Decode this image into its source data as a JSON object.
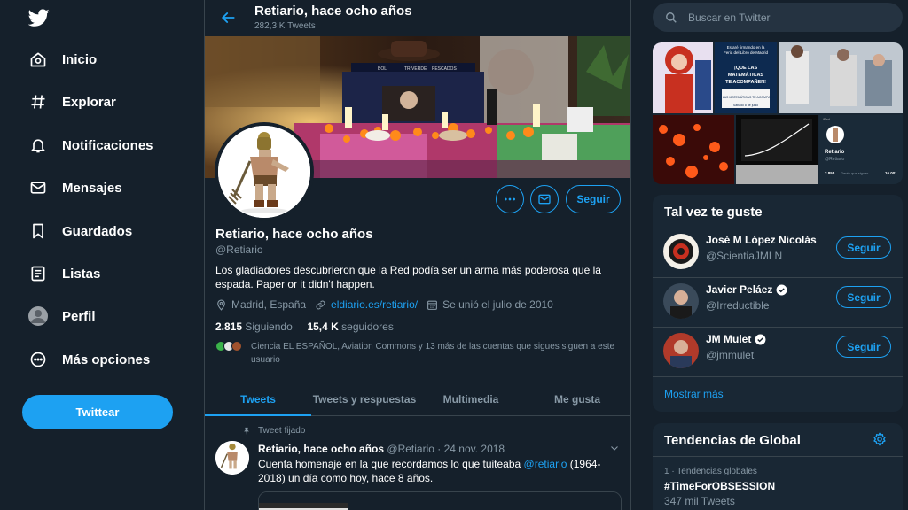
{
  "nav": {
    "items": [
      {
        "label": "Inicio",
        "icon": "home-icon"
      },
      {
        "label": "Explorar",
        "icon": "hashtag-icon"
      },
      {
        "label": "Notificaciones",
        "icon": "bell-icon"
      },
      {
        "label": "Mensajes",
        "icon": "envelope-icon"
      },
      {
        "label": "Guardados",
        "icon": "bookmark-icon"
      },
      {
        "label": "Listas",
        "icon": "list-icon"
      },
      {
        "label": "Perfil",
        "icon": "profile-avatar"
      },
      {
        "label": "Más opciones",
        "icon": "more-circle-icon"
      }
    ],
    "tweet_button": "Twittear"
  },
  "header": {
    "title": "Retiario, hace ocho años",
    "tweet_count": "282,3 K Tweets"
  },
  "banner": {
    "sign_words": [
      "BOLI",
      "TRIVERDE",
      "PESCADOS"
    ]
  },
  "profile": {
    "name": "Retiario, hace ocho años",
    "handle": "@Retiario",
    "bio": "Los gladiadores descubrieron que la Red podía ser un arma más poderosa que la espada. Paper or it didn't happen.",
    "location": "Madrid, España",
    "website": "eldiario.es/retiario/",
    "joined": "Se unió el julio de 2010",
    "following_count": "2.815",
    "following_label": "Siguiendo",
    "followers_count": "15,4 K",
    "followers_label": "seguidores",
    "known_followers": "Ciencia EL ESPAÑOL, Aviation Commons y 13 más de las cuentas que sigues siguen a este usuario",
    "follow_button": "Seguir"
  },
  "tabs": [
    "Tweets",
    "Tweets y respuestas",
    "Multimedia",
    "Me gusta"
  ],
  "pinned_tweet": {
    "pinned_label": "Tweet fijado",
    "author": "Retiario, hace ocho años",
    "handle": "@Retiario",
    "date": "· 24 nov. 2018",
    "text_before": "Cuenta homenaje en la que recordamos lo que tuiteaba ",
    "mention": "@retiario",
    "text_after": " (1964-2018) un día como hoy, hace 8 años."
  },
  "sidebar": {
    "search_placeholder": "Buscar en Twitter",
    "media_preview": {
      "poster_line1": "Estaré firmando en la",
      "poster_line2": "Feria del Libro de Madrid",
      "poster_title1": "¡QUE LAS",
      "poster_title2": "MATEMÁTICAS",
      "poster_title3": "TE ACOMPAÑEN!",
      "book_title": "QUE LAS MATEMÁTICAS TE ACOMPAÑEN",
      "poster_date": "Sábado 8 de junio",
      "mini_name": "Retiario",
      "mini_handle": "@Retiario",
      "mini_stats_a": "2.855",
      "mini_stats_a_label": "Gente que sigues",
      "mini_stats_b": "16.001",
      "mini_device": "iPad"
    },
    "suggestions_title": "Tal vez te guste",
    "suggestions": [
      {
        "name": "José M López Nicolás",
        "handle": "@ScientiaJMLN",
        "verified": false,
        "button": "Seguir"
      },
      {
        "name": "Javier Peláez",
        "handle": "@Irreductible",
        "verified": true,
        "button": "Seguir"
      },
      {
        "name": "JM Mulet",
        "handle": "@jmmulet",
        "verified": true,
        "button": "Seguir"
      }
    ],
    "show_more": "Mostrar más",
    "trends_title": "Tendencias de Global",
    "trends": [
      {
        "context": "1 · Tendencias globales",
        "name": "#TimeForOBSESSION",
        "count": "347 mil Tweets"
      }
    ]
  },
  "colors": {
    "background": "#15202b",
    "card": "#192734",
    "accent": "#1da1f2",
    "muted": "#8899a6",
    "border": "#38444d"
  }
}
